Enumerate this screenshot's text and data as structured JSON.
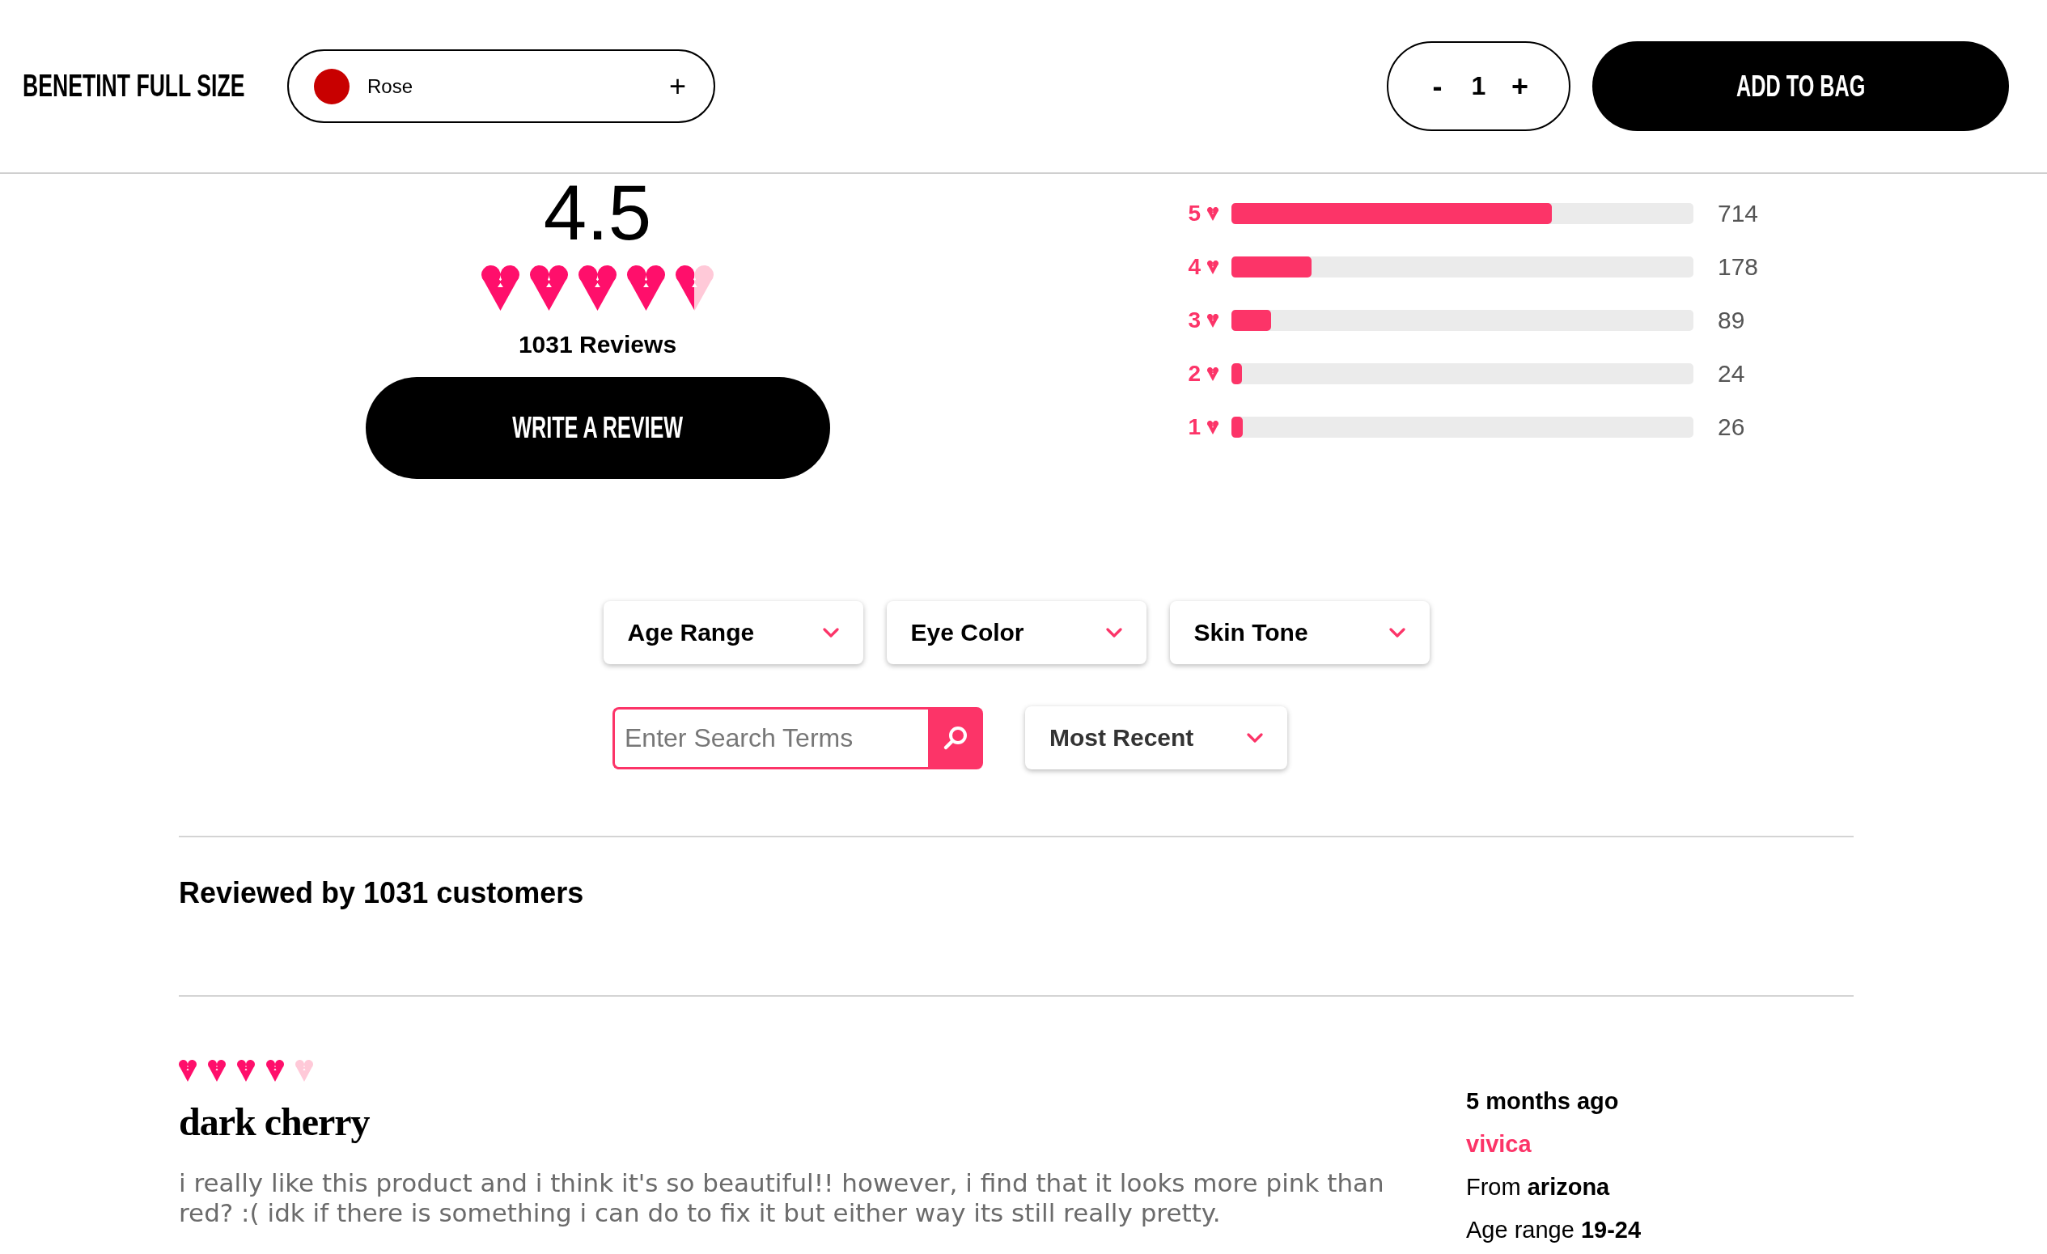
{
  "header": {
    "product_title": "BENETINT FULL SIZE",
    "shade_selector": {
      "shade": "Rose",
      "color": "#c80000",
      "expand_symbol": "+"
    },
    "quantity": {
      "decrease": "-",
      "value": "1",
      "increase": "+"
    },
    "add_to_bag": "ADD TO BAG"
  },
  "rating_summary": {
    "average": "4.5",
    "stars": 4.5,
    "review_count": "1031 Reviews",
    "write_review": "WRITE A REVIEW"
  },
  "rating_breakdown": [
    {
      "label": "5",
      "level": 0.693,
      "count": "714"
    },
    {
      "label": "4",
      "level": 0.173,
      "count": "178"
    },
    {
      "label": "3",
      "level": 0.086,
      "count": "89"
    },
    {
      "label": "2",
      "level": 0.023,
      "count": "24"
    },
    {
      "label": "1",
      "level": 0.025,
      "count": "26"
    }
  ],
  "filters": [
    {
      "label": "Age Range"
    },
    {
      "label": "Eye Color"
    },
    {
      "label": "Skin Tone"
    }
  ],
  "search": {
    "placeholder": "Enter Search Terms"
  },
  "sort": {
    "value": "Most Recent"
  },
  "reviews_heading": "Reviewed by 1031 customers",
  "reviews": [
    {
      "stars": 4,
      "title": "dark cherry",
      "body": "i really like this product and i think it's so beautiful!! however, i find that it looks more pink than red? :( idk if there is something i can do to fix it but either way its still really pretty.",
      "date": "5 months ago",
      "author": "vivica",
      "location": "From **arizona**",
      "age_range": "Age range **19-24**"
    }
  ]
}
